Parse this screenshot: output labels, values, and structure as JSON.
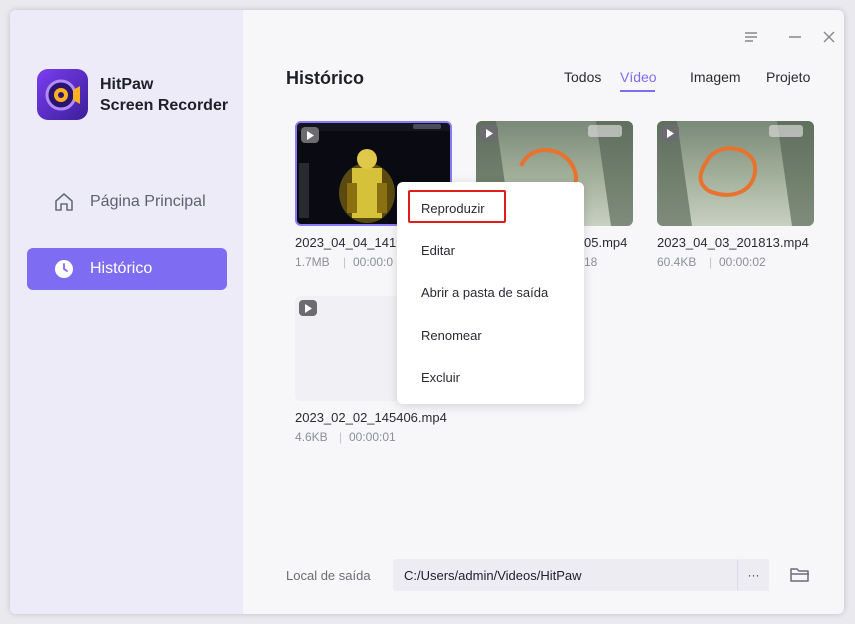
{
  "app": {
    "name_line1": "HitPaw",
    "name_line2": "Screen Recorder"
  },
  "sidebar": {
    "items": [
      {
        "label": "Página Principal",
        "active": false
      },
      {
        "label": "Histórico",
        "active": true
      }
    ]
  },
  "main": {
    "title": "Histórico",
    "tabs": [
      {
        "label": "Todos",
        "active": false
      },
      {
        "label": "Vídeo",
        "active": true
      },
      {
        "label": "Imagem",
        "active": false
      },
      {
        "label": "Projeto",
        "active": false
      }
    ],
    "files": [
      {
        "name": "2023_04_04_1419",
        "size": "1.7MB",
        "duration": "00:00:0"
      },
      {
        "name": "05.mp4",
        "size": "",
        "duration": "18"
      },
      {
        "name": "2023_04_03_201813.mp4",
        "size": "60.4KB",
        "duration": "00:00:02"
      },
      {
        "name": "2023_02_02_145406.mp4",
        "size": "4.6KB",
        "duration": "00:00:01"
      }
    ]
  },
  "context_menu": {
    "items": [
      "Reproduzir",
      "Editar",
      "Abrir a pasta de saída",
      "Renomear",
      "Excluir"
    ]
  },
  "footer": {
    "output_label": "Local de saída",
    "output_path": "C:/Users/admin/Videos/HitPaw",
    "more_label": "···"
  },
  "colors": {
    "accent": "#7e6cf2",
    "highlight": "#e21b1b"
  }
}
